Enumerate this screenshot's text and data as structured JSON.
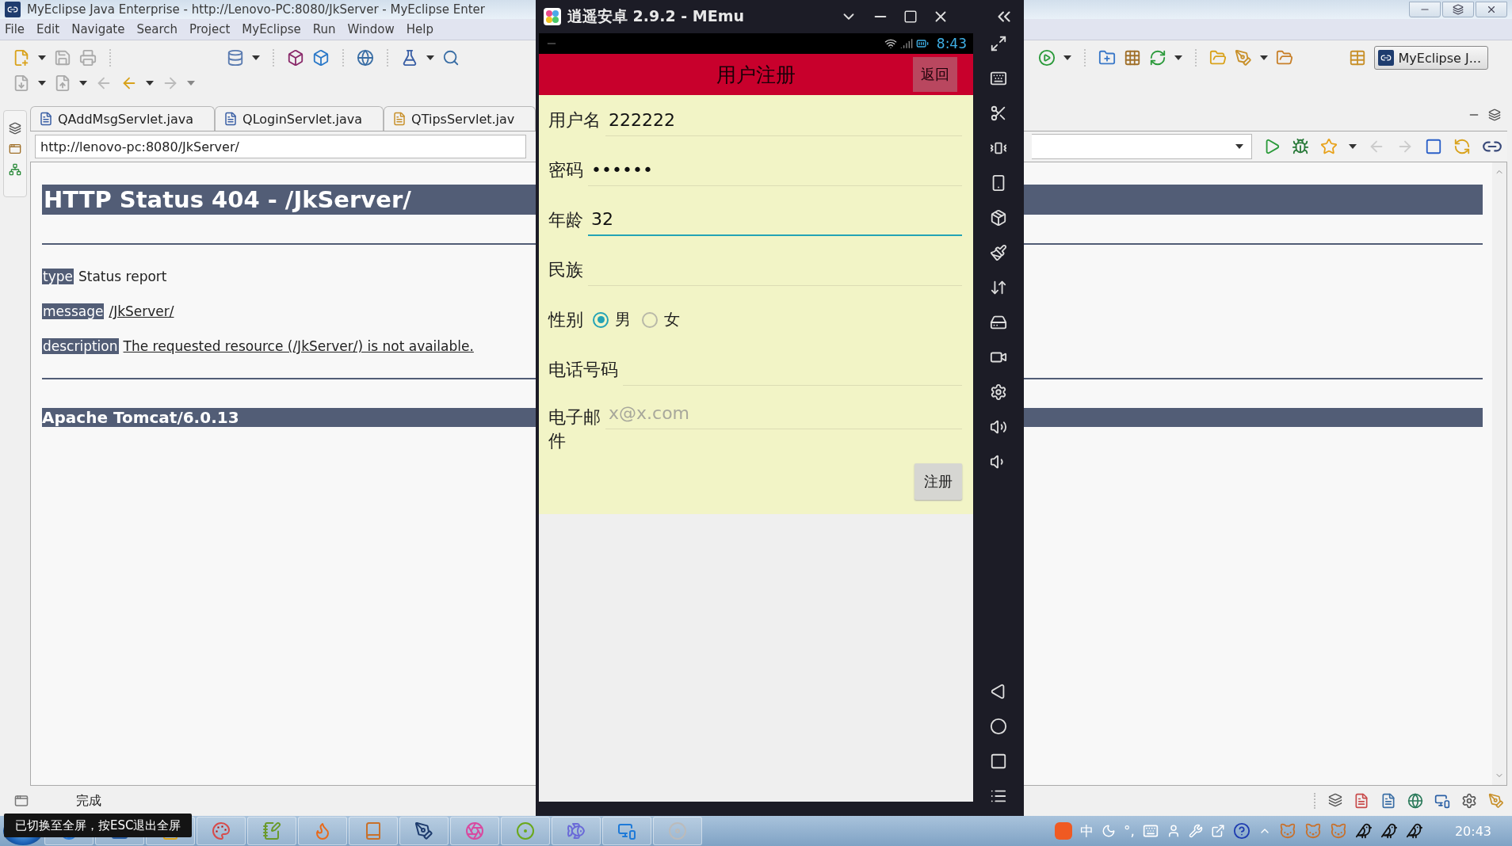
{
  "ide": {
    "title": "MyEclipse Java Enterprise - http://Lenovo-PC:8080/JkServer - MyEclipse Enter",
    "menu": [
      "File",
      "Edit",
      "Navigate",
      "Search",
      "Project",
      "MyEclipse",
      "Run",
      "Window",
      "Help"
    ],
    "perspective": "MyEclipse J...",
    "editor_tabs": [
      {
        "label": "QAddMsgServlet.java",
        "selected": false,
        "warning": false
      },
      {
        "label": "QLoginServlet.java",
        "selected": false,
        "warning": false
      },
      {
        "label": "QTipsServlet.jav",
        "selected": false,
        "warning": true
      }
    ],
    "url": "http://lenovo-pc:8080/JkServer/",
    "page": {
      "heading": "HTTP Status 404 - /JkServer/",
      "fields": [
        {
          "label": "type",
          "value": "Status report",
          "link": false
        },
        {
          "label": "message",
          "value": "/JkServer/",
          "link": true
        },
        {
          "label": "description",
          "value": "The requested resource (/JkServer/) is not available.",
          "link": true
        }
      ],
      "footer": "Apache Tomcat/6.0.13"
    },
    "status": "完成"
  },
  "emulator": {
    "title": "逍遥安卓 2.9.2 - MEmu",
    "clock": "8:43",
    "app_title": "用户注册",
    "back": "返回",
    "form": [
      {
        "kind": "text",
        "label": "用户名",
        "value": "222222",
        "focused": false
      },
      {
        "kind": "password",
        "label": "密码",
        "value": "••••••",
        "focused": false
      },
      {
        "kind": "text",
        "label": "年龄",
        "value": "32",
        "focused": true
      },
      {
        "kind": "text",
        "label": "民族",
        "focused": false
      },
      {
        "kind": "radio",
        "label": "性别",
        "options": [
          {
            "label": "男",
            "selected": true
          },
          {
            "label": "女",
            "selected": false
          }
        ]
      },
      {
        "kind": "text",
        "label": "电话号码",
        "focused": false
      },
      {
        "kind": "email",
        "label": "电子邮件",
        "placeholder": "x@x.com",
        "focused": false
      }
    ],
    "submit": "注册"
  },
  "tooltip": "已切换至全屏，按ESC退出全屏",
  "taskbar": {
    "tray_texts": [
      "中",
      "°,"
    ],
    "clock": "20:43"
  }
}
